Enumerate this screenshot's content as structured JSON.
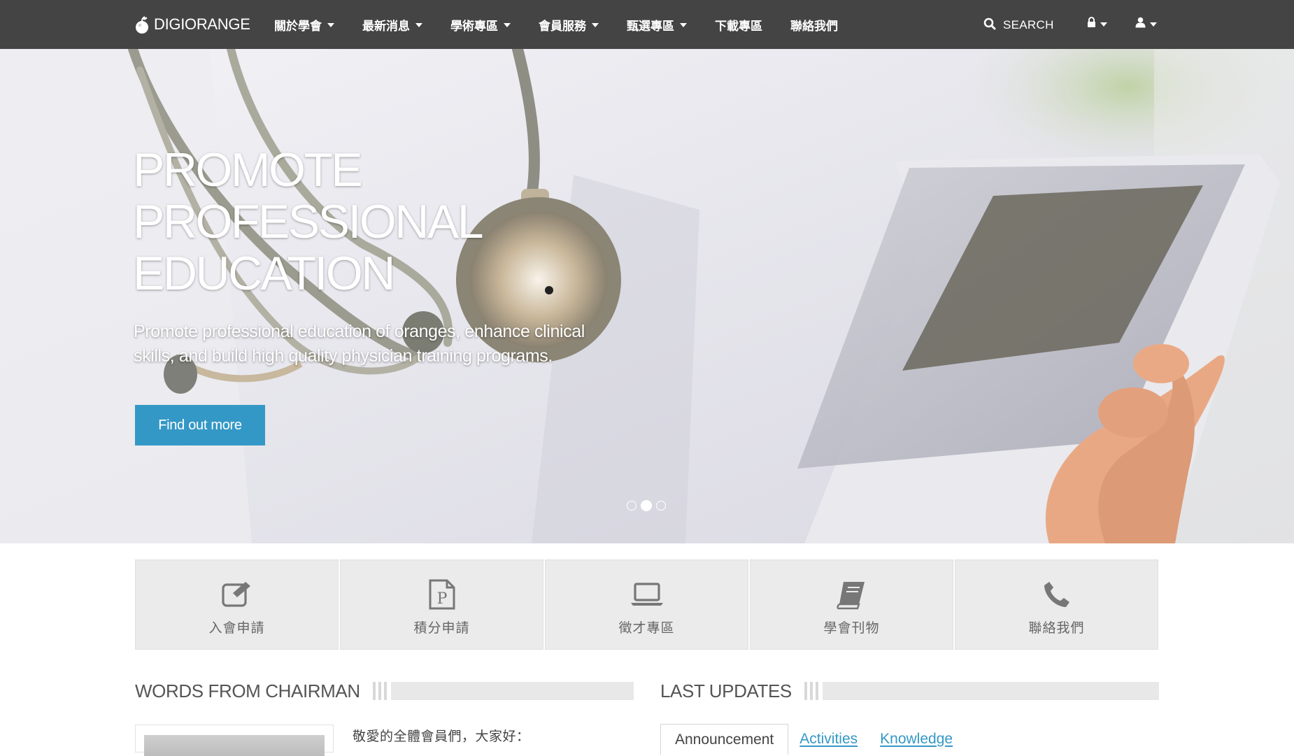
{
  "navbar": {
    "brand": "DIGIORANGE",
    "menu": [
      {
        "label": "關於學會",
        "has_dropdown": true
      },
      {
        "label": "最新消息",
        "has_dropdown": true
      },
      {
        "label": "學術專區",
        "has_dropdown": true
      },
      {
        "label": "會員服務",
        "has_dropdown": true
      },
      {
        "label": "甄選專區",
        "has_dropdown": true
      },
      {
        "label": "下載專區",
        "has_dropdown": false
      },
      {
        "label": "聯絡我們",
        "has_dropdown": false
      }
    ],
    "search_label": "SEARCH",
    "search_icon": "search-icon",
    "lock_icon": "lock-icon",
    "user_icon": "user-icon",
    "bg_color": "#444444"
  },
  "hero": {
    "title": "PROMOTE\nPROFESSIONAL\nEDUCATION",
    "subtitle": "Promote professional education of oranges, enhance clinical skills, and build high quality physician training programs.",
    "button_label": "Find out more",
    "button_color": "#3498c6",
    "slide_count": 3,
    "active_slide": 2
  },
  "quick_links": [
    {
      "label": "入會申請",
      "icon": "edit-icon"
    },
    {
      "label": "積分申請",
      "icon": "points-document-icon"
    },
    {
      "label": "徵才專區",
      "icon": "laptop-icon"
    },
    {
      "label": "學會刊物",
      "icon": "book-icon"
    },
    {
      "label": "聯絡我們",
      "icon": "phone-icon"
    }
  ],
  "chairman": {
    "title": "WORDS FROM CHAIRMAN",
    "text": "敬愛的全體會員們，大家好："
  },
  "updates": {
    "title": "LAST UPDATES",
    "tabs": [
      {
        "label": "Announcement",
        "active": true
      },
      {
        "label": "Activities",
        "active": false
      },
      {
        "label": "Knowledge",
        "active": false
      }
    ]
  }
}
